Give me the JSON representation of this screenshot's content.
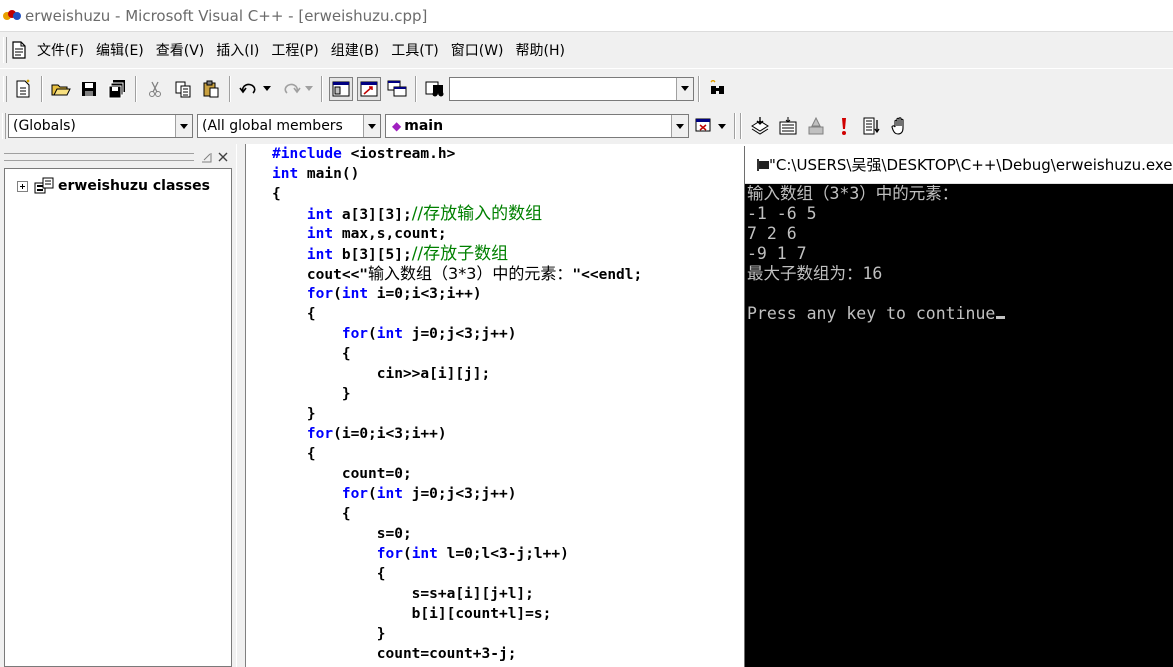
{
  "window": {
    "title": "erweishuzu - Microsoft Visual C++ - [erweishuzu.cpp]"
  },
  "menu": {
    "items": [
      {
        "label": "文件(F)"
      },
      {
        "label": "编辑(E)"
      },
      {
        "label": "查看(V)"
      },
      {
        "label": "插入(I)"
      },
      {
        "label": "工程(P)"
      },
      {
        "label": "组建(B)"
      },
      {
        "label": "工具(T)"
      },
      {
        "label": "窗口(W)"
      },
      {
        "label": "帮助(H)"
      }
    ]
  },
  "toolbar": {
    "find_combo_value": ""
  },
  "wizardbar": {
    "class_combo": "(Globals)",
    "filter_combo": "(All global members",
    "member_combo": "main"
  },
  "workspace": {
    "tree_root_label": "erweishuzu classes"
  },
  "editor": {
    "lines": [
      "#include <iostream.h>",
      "int main()",
      "{",
      "    int a[3][3];//存放输入的数组",
      "    int max,s,count;",
      "    int b[3][5];//存放子数组",
      "    cout<<\"输入数组（3*3）中的元素：\"<<endl;",
      "    for(int i=0;i<3;i++)",
      "    {",
      "        for(int j=0;j<3;j++)",
      "        {",
      "            cin>>a[i][j];",
      "        }",
      "    }",
      "    for(i=0;i<3;i++)",
      "    {",
      "        count=0;",
      "        for(int j=0;j<3;j++)",
      "        {",
      "            s=0;",
      "            for(int l=0;l<3-j;l++)",
      "            {",
      "                s=s+a[i][j+l];",
      "                b[i][count+l]=s;",
      "            }",
      "            count=count+3-j;"
    ]
  },
  "console": {
    "title": "\"C:\\USERS\\吴强\\DESKTOP\\C++\\Debug\\erweishuzu.exe\"",
    "lines": [
      "输入数组（3*3）中的元素：",
      "-1 -6 5",
      "7 2 6",
      "-9 1 7",
      "最大子数组为：16",
      "",
      "Press any key to continue"
    ]
  },
  "colors": {
    "keyword": "#0000ff",
    "comment": "#008000",
    "console_bg": "#000000",
    "console_fg": "#c0c0c0",
    "chrome": "#f0f0f0"
  }
}
